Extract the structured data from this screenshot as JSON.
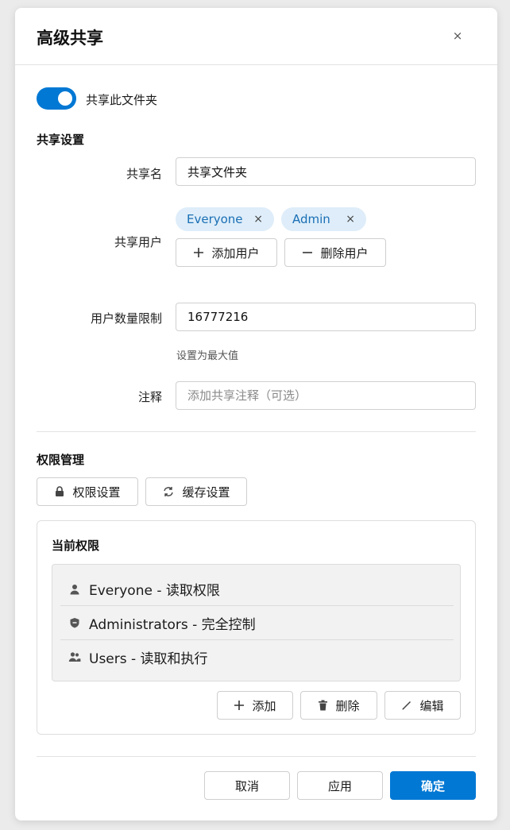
{
  "colors": {
    "accent": "#0078d4",
    "chip_bg": "#deedf9",
    "chip_text": "#1a6fb5"
  },
  "dialog": {
    "title": "高级共享",
    "close_label": "×"
  },
  "share_toggle": {
    "label": "共享此文件夹",
    "on": true
  },
  "share_settings": {
    "section_title": "共享设置",
    "share_name": {
      "label": "共享名",
      "value": "共享文件夹"
    },
    "share_users": {
      "label": "共享用户",
      "chips": [
        {
          "label": "Everyone",
          "remove": "×"
        },
        {
          "label": "Admin",
          "remove": "×"
        }
      ],
      "add_button": "添加用户",
      "remove_button": "删除用户"
    },
    "user_limit": {
      "label": "用户数量限制",
      "value": "16777216",
      "hint": "设置为最大值"
    },
    "comment": {
      "label": "注释",
      "placeholder": "添加共享注释（可选）",
      "value": ""
    }
  },
  "permissions": {
    "section_title": "权限管理",
    "perm_settings_button": "权限设置",
    "cache_settings_button": "缓存设置",
    "current_title": "当前权限",
    "entries": [
      {
        "text": "Everyone - 读取权限",
        "icon": "user-icon"
      },
      {
        "text": "Administrators - 完全控制",
        "icon": "shield-icon"
      },
      {
        "text": "Users - 读取和执行",
        "icon": "users-icon"
      }
    ],
    "add_button": "添加",
    "delete_button": "删除",
    "edit_button": "编辑"
  },
  "footer": {
    "cancel": "取消",
    "apply": "应用",
    "ok": "确定"
  }
}
